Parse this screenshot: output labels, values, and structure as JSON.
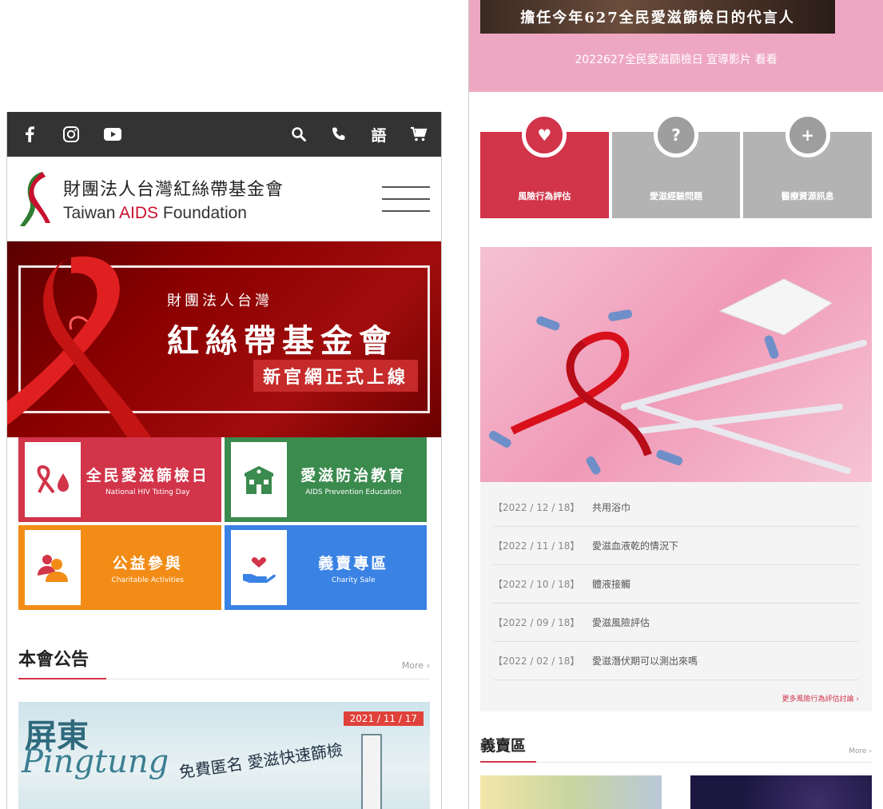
{
  "left": {
    "topbar": {
      "icons": [
        "facebook-icon",
        "instagram-icon",
        "youtube-icon",
        "search-icon",
        "phone-icon",
        "language-icon",
        "cart-icon"
      ],
      "language_glyph": "語"
    },
    "logo": {
      "zh": "財團法人台灣紅絲帶基金會",
      "en_prefix": "Taiwan ",
      "en_aids": "AIDS",
      "en_suffix": " Foundation"
    },
    "banner": {
      "sub": "財團法人台灣",
      "main": "紅絲帶基金會",
      "badge": "新官網正式上線"
    },
    "tiles": [
      {
        "zh": "全民愛滋篩檢日",
        "en": "National HIV Tsting Day"
      },
      {
        "zh": "愛滋防治教育",
        "en": "AIDS Prevention Education"
      },
      {
        "zh": "公益參與",
        "en": "Charitable Activities"
      },
      {
        "zh": "義賣專區",
        "en": "Charity Sale"
      }
    ],
    "notice": {
      "title": "本會公告",
      "more": "More ›",
      "image": {
        "date": "2021 / 11 / 17",
        "line1": "屏東",
        "line2": "Pingtung",
        "caption": "免費匿名 愛滋快速篩檢"
      }
    }
  },
  "right": {
    "video": {
      "strip": "擔任今年627全民愛滋篩檢日的代言人",
      "caption": "2022627全民愛滋篩檢日 宣導影片 看看"
    },
    "tabs": [
      {
        "label": "風險行為評估",
        "symbol": "♥"
      },
      {
        "label": "愛滋經驗問題",
        "symbol": "?"
      },
      {
        "label": "醫療資源訊息",
        "symbol": "+"
      }
    ],
    "list": [
      {
        "date": "【2022 / 12 / 18】",
        "title": "共用浴巾"
      },
      {
        "date": "【2022 / 11 / 18】",
        "title": "愛滋血液乾的情況下"
      },
      {
        "date": "【2022 / 10 / 18】",
        "title": "體液接觸"
      },
      {
        "date": "【2022 / 09 / 18】",
        "title": "愛滋風險評估"
      },
      {
        "date": "【2022 / 02 / 18】",
        "title": "愛滋潛伏期可以測出來嗎"
      }
    ],
    "list_more": "更多風險行為評估討論 ›",
    "sale": {
      "title": "義賣區",
      "more": "More ›"
    }
  },
  "colors": {
    "dark_bar": "#333333",
    "brand_red": "#d2344a",
    "tile_green": "#3b8a4e",
    "tile_orange": "#f28c17",
    "tile_blue": "#3a82e4",
    "banner_red": "#8b0000",
    "pink": "#eea7c2",
    "tab_gray": "#b3b3b3"
  }
}
